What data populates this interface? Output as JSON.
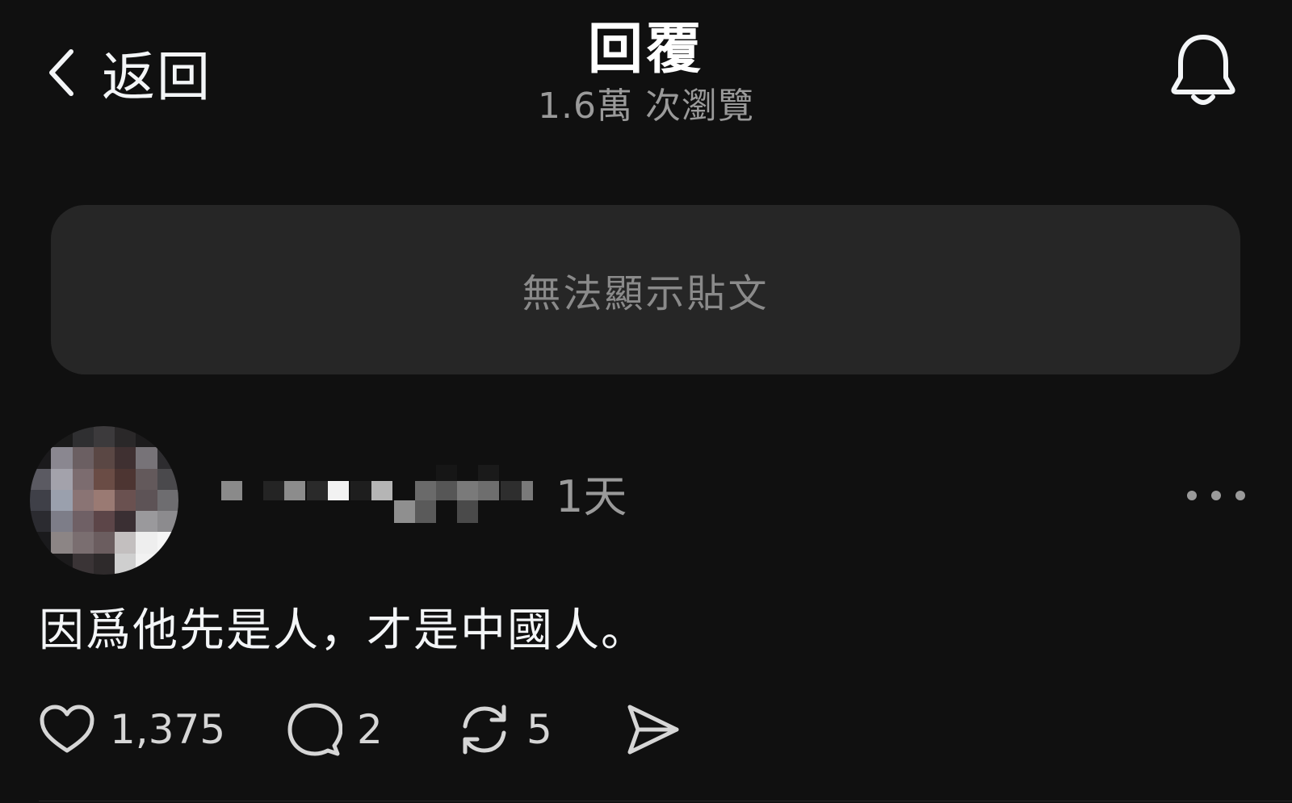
{
  "header": {
    "back_label": "返回",
    "title": "回覆",
    "views": "1.6萬 次瀏覽"
  },
  "post": {
    "unavailable_message": "無法顯示貼文"
  },
  "reply": {
    "timestamp": "1天",
    "text": "因爲他先是人，才是中國人。",
    "likes": "1,375",
    "comments": "2",
    "reposts": "5"
  },
  "icons": {
    "back": "chevron-left-icon",
    "notifications": "bell-icon",
    "more": "ellipsis-icon",
    "like": "heart-icon",
    "comment": "comment-bubble-icon",
    "repost": "repost-icon",
    "share": "send-icon"
  },
  "colors": {
    "background": "#101010",
    "card": "#262626",
    "primary_text": "#f3f5f7",
    "secondary_text": "#9a9a9a"
  }
}
